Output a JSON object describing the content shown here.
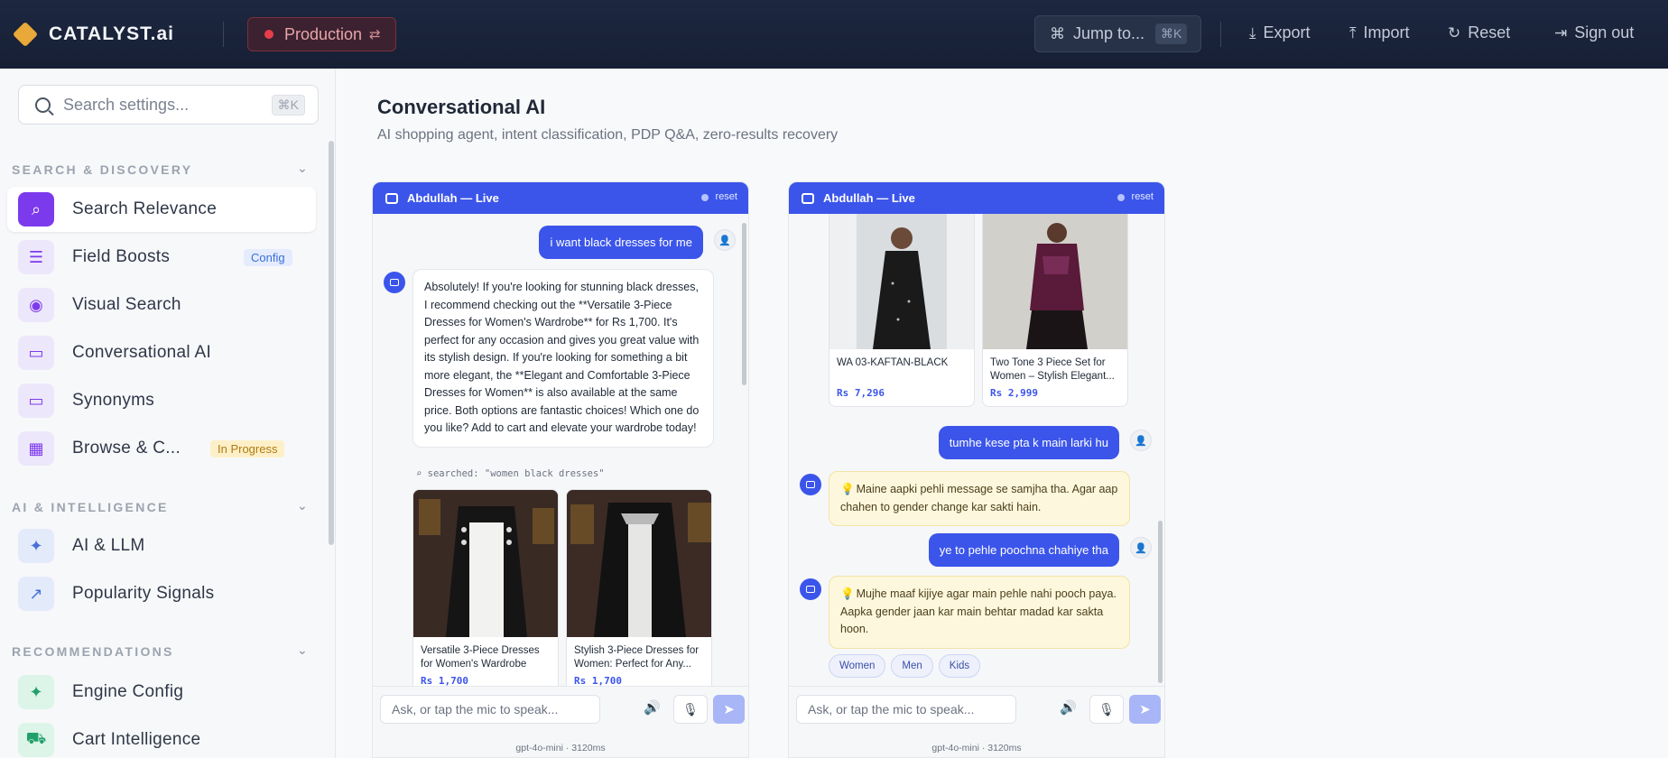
{
  "topbar": {
    "brand": "CATALYST.ai",
    "environment": "Production",
    "jump_label": "Jump to...",
    "jump_kbd": "⌘K",
    "actions": {
      "export": "Export",
      "import": "Import",
      "reset": "Reset",
      "sign_out": "Sign out"
    }
  },
  "sidebar": {
    "search_placeholder": "Search settings...",
    "search_kbd": "⌘K",
    "sections": [
      {
        "title": "SEARCH & DISCOVERY"
      },
      {
        "title": "AI & INTELLIGENCE"
      },
      {
        "title": "RECOMMENDATIONS"
      }
    ],
    "items": [
      {
        "label": "Search Relevance",
        "icon": "search-icon",
        "active": true
      },
      {
        "label": "Field Boosts",
        "icon": "sliders-icon",
        "badge": "Config"
      },
      {
        "label": "Visual Search",
        "icon": "eye-icon"
      },
      {
        "label": "Conversational AI",
        "icon": "chat-icon"
      },
      {
        "label": "Synonyms",
        "icon": "chat-icon"
      },
      {
        "label": "Browse & C...",
        "icon": "grid-icon",
        "badge": "In Progress"
      },
      {
        "label": "AI & LLM",
        "icon": "sparkle-icon"
      },
      {
        "label": "Popularity Signals",
        "icon": "trend-icon"
      },
      {
        "label": "Engine Config",
        "icon": "sparkle-icon"
      },
      {
        "label": "Cart Intelligence",
        "icon": "cart-icon"
      }
    ]
  },
  "main": {
    "title": "Conversational AI",
    "subtitle": "AI shopping agent, intent classification, PDP Q&A, zero-results recovery"
  },
  "chats": [
    {
      "header": "Abdullah — Live",
      "reset": "reset",
      "user_msg_1": "i want black dresses for me",
      "bot_msg_1": "Absolutely! If you're looking for stunning black dresses, I recommend checking out the **Versatile 3-Piece Dresses for Women's Wardrobe** for Rs 1,700. It's perfect for any occasion and gives you great value with its stylish design. If you're looking for something a bit more elegant, the **Elegant and Comfortable 3-Piece Dresses for Women** is also available at the same price. Both options are fantastic choices! Which one do you like? Add to cart and elevate your wardrobe today!",
      "searched": "searched: \"women black dresses\"",
      "products": [
        {
          "name": "Versatile 3-Piece Dresses for Women's Wardrobe",
          "price": "Rs 1,700"
        },
        {
          "name": "Stylish 3-Piece Dresses for Women: Perfect for Any...",
          "price": "Rs 1,700"
        }
      ],
      "input_placeholder": "Ask, or tap the mic to speak...",
      "model": "gpt-4o-mini · 3120ms"
    },
    {
      "header": "Abdullah — Live",
      "reset": "reset",
      "products": [
        {
          "name": "WA 03-KAFTAN-BLACK",
          "price": "Rs 7,296"
        },
        {
          "name": "Two Tone 3 Piece Set for Women – Stylish Elegant...",
          "price": "Rs 2,999"
        }
      ],
      "user_msg_1": "tumhe kese pta k main larki hu",
      "bot_msg_1": "Maine aapki pehli message se samjha tha. Agar aap chahen to gender change kar sakti hain.",
      "user_msg_2": "ye to pehle poochna chahiye tha",
      "bot_msg_2": "Mujhe maaf kijiye agar main pehle nahi pooch paya. Aapka gender jaan kar main behtar madad kar sakta hoon.",
      "chips": [
        "Women",
        "Men",
        "Kids"
      ],
      "input_placeholder": "Ask, or tap the mic to speak...",
      "model": "gpt-4o-mini · 3120ms"
    }
  ],
  "colors": {
    "accent": "#3b55ea",
    "topbar": "#1b253c",
    "env_danger": "#e53e4a",
    "hint_bg": "#fdf7dd"
  }
}
